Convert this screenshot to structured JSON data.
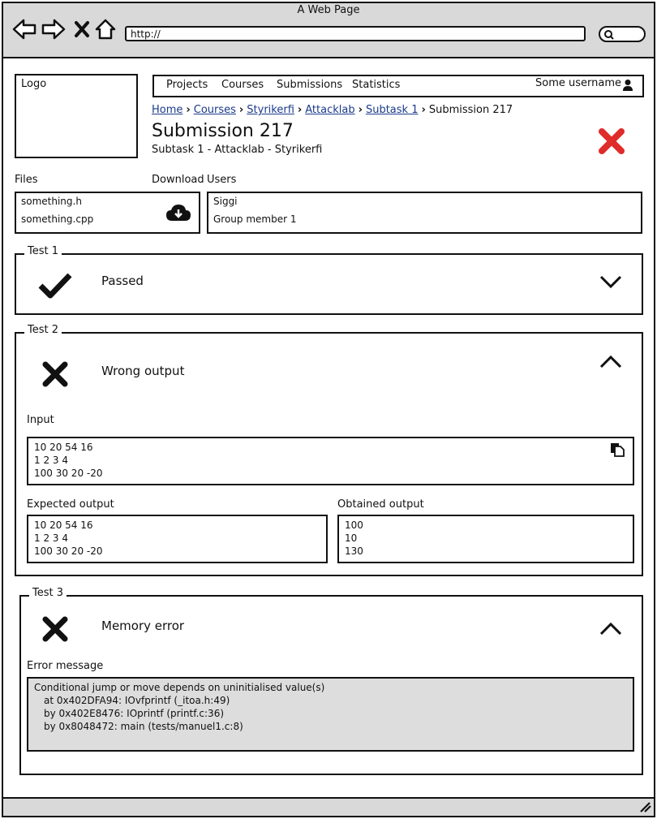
{
  "window": {
    "title": "A Web Page",
    "url": "http://"
  },
  "logo": {
    "label": "Logo"
  },
  "menu": {
    "items": [
      "Projects",
      "Courses",
      "Submissions",
      "Statistics"
    ],
    "username": "Some username"
  },
  "breadcrumb": {
    "items": [
      "Home",
      "Courses",
      "Styrikerfi",
      "Attacklab",
      "Subtask 1"
    ],
    "current": "Submission 217"
  },
  "submission": {
    "title": "Submission 217",
    "subtitle": "Subtask 1 - Attacklab - Styrikerfi",
    "status_icon": "x-icon",
    "status_color": "#e02b2b"
  },
  "files": {
    "label": "Files",
    "download_label": "Download",
    "items": [
      "something.h",
      "something.cpp"
    ]
  },
  "users": {
    "label": "Users",
    "items": [
      "Siggi",
      "Group member 1"
    ]
  },
  "tests": [
    {
      "legend": "Test 1",
      "status": "Passed",
      "icon": "check-icon",
      "expanded": false
    },
    {
      "legend": "Test 2",
      "status": "Wrong output",
      "icon": "x-icon",
      "expanded": true,
      "input_label": "Input",
      "input": [
        "10 20 54 16",
        "1 2 3 4",
        "100 30 20 -20"
      ],
      "expected_label": "Expected output",
      "expected": [
        "10 20 54 16",
        "1 2 3 4",
        "100 30 20 -20"
      ],
      "obtained_label": "Obtained output",
      "obtained": [
        "100",
        "10",
        "130"
      ]
    },
    {
      "legend": "Test 3",
      "status": "Memory error",
      "icon": "x-icon",
      "expanded": true,
      "error_label": "Error message",
      "error_lines": [
        "Conditional jump or move depends on uninitialised value(s)",
        "at 0x402DFA94: IOvfprintf (_itoa.h:49)",
        "by 0x402E8476: IOprintf (printf.c:36)",
        "by 0x8048472: main (tests/manuel1.c:8)"
      ]
    }
  ]
}
